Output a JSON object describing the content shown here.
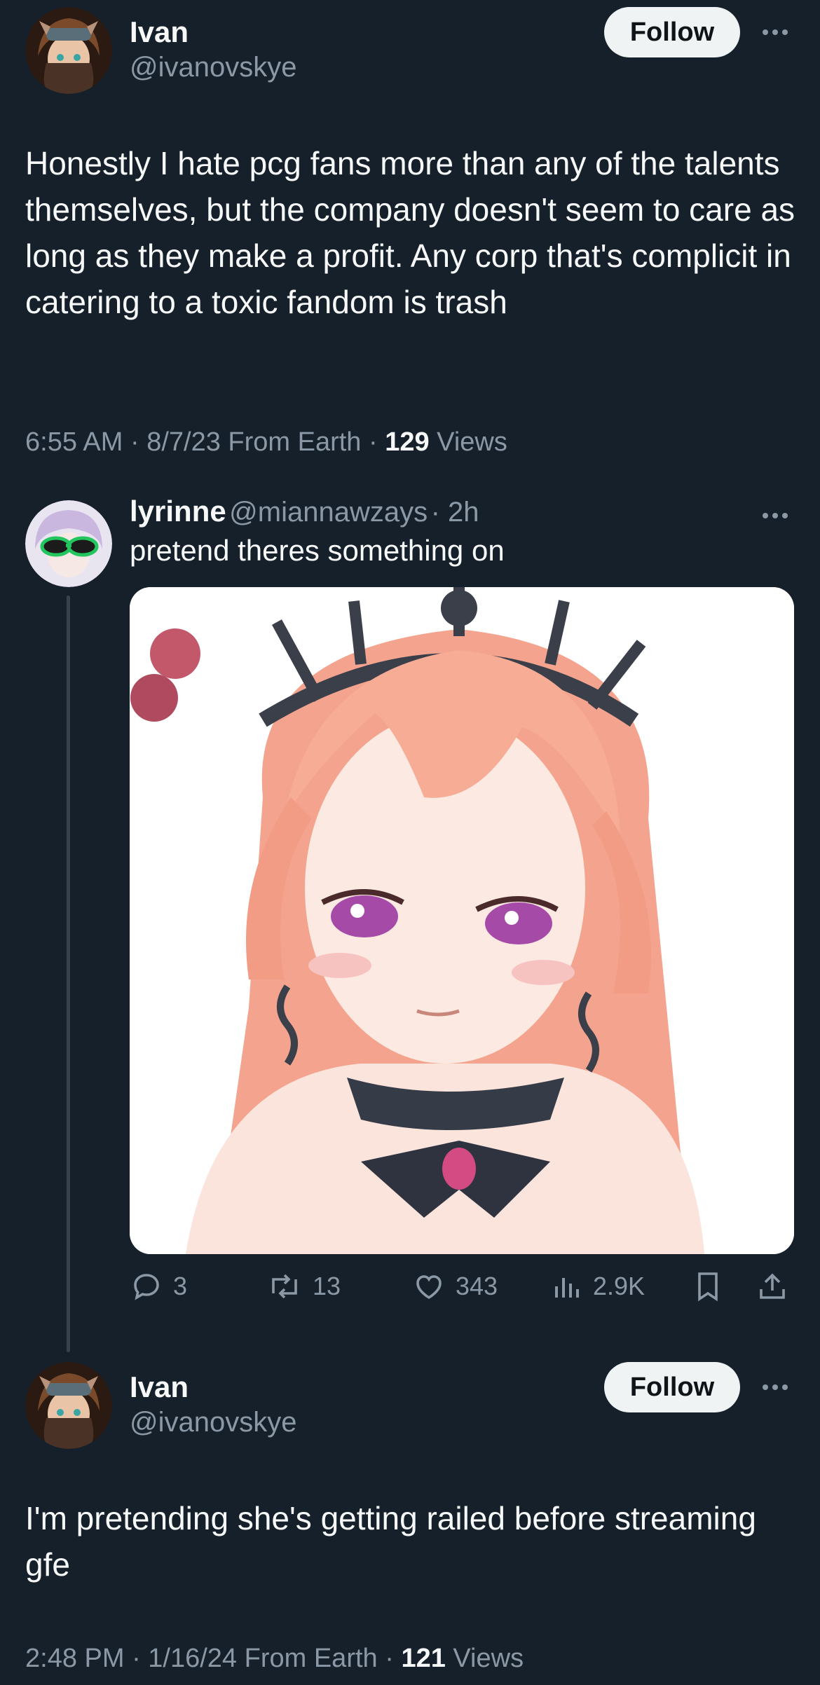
{
  "main_tweet": {
    "author_name": "Ivan",
    "author_handle": "@ivanovskye",
    "follow_label": "Follow",
    "text": "Honestly I hate pcg fans more than any of the talents themselves, but the company doesn't seem to care as long as they make a profit. Any corp that's complicit in catering to a toxic fandom is trash",
    "time": "6:55 AM · 8/7/23 From Earth · ",
    "views_count": "129",
    "views_label": " Views"
  },
  "reply": {
    "author_name": "lyrinne",
    "author_handle": "@miannawzays",
    "age": "· 2h",
    "text": "pretend theres something on",
    "replies": "3",
    "reposts": "13",
    "likes": "343",
    "views": "2.9K",
    "icons": [
      "reply-icon",
      "repost-icon",
      "like-icon",
      "views-icon",
      "bookmark-icon",
      "share-icon"
    ]
  },
  "second_tweet": {
    "author_name": "Ivan",
    "author_handle": "@ivanovskye",
    "follow_label": "Follow",
    "text": "I'm pretending she's getting railed before streaming gfe",
    "time": "2:48 PM · 1/16/24 From Earth · ",
    "views_count": "121",
    "views_label": " Views"
  },
  "colors": {
    "background": "#15202b",
    "text": "#f7f9f9",
    "secondary": "#8b98a5",
    "follow_bg": "#eff3f4",
    "thread_line": "#38444d"
  }
}
